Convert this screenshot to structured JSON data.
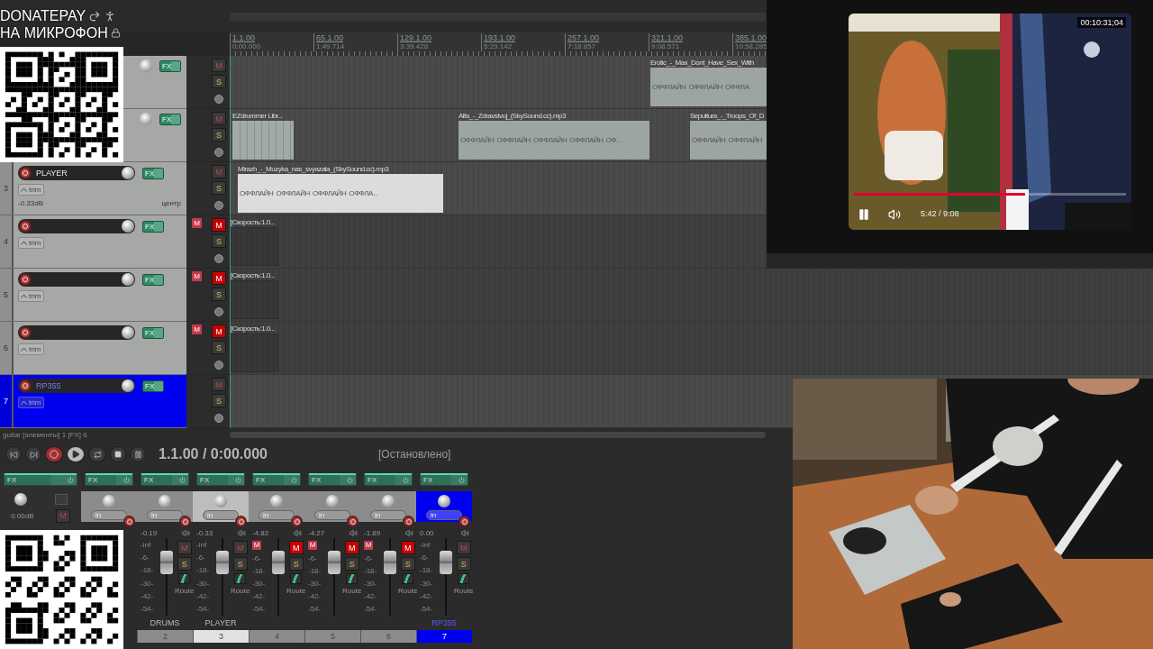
{
  "overlay": {
    "donate_title": "DONATEPAY",
    "donate_subtitle": "НА МИКРОФОН"
  },
  "ruler": [
    {
      "bar": "1.1.00",
      "time": "0:00.000"
    },
    {
      "bar": "65.1.00",
      "time": "1:49.714"
    },
    {
      "bar": "129.1.00",
      "time": "3:39.428"
    },
    {
      "bar": "193.1.00",
      "time": "5:29.142"
    },
    {
      "bar": "257.1.00",
      "time": "7:18.857"
    },
    {
      "bar": "321.1.00",
      "time": "9:08.571"
    },
    {
      "bar": "385.1.00",
      "time": "10:58.285"
    }
  ],
  "tracks": [
    {
      "selected": false,
      "muted": false,
      "fx": "FX",
      "mute": "M",
      "solo": "S",
      "items": [
        {
          "kind": "audio",
          "selected": false,
          "title": "Erotic_-_Max_Dont_Have_Sex_With",
          "offline": [
            "ОФФЛАЙН",
            "ОФФЛАЙН",
            "ОФФЛА"
          ]
        }
      ]
    },
    {
      "selected": false,
      "muted": false,
      "fx": "FX",
      "mute": "M",
      "solo": "S",
      "items": [
        {
          "kind": "midi",
          "selected": false,
          "title": "EZdrummer Libr..."
        },
        {
          "kind": "audio",
          "selected": false,
          "title": "Alfa_-_Zdravstvuj_(SkySound.cc).mp3",
          "offline": [
            "ОФФЛАЙН",
            "ОФФЛАЙН",
            "ОФФЛАЙН",
            "ОФФЛАЙН",
            "ОФ..."
          ]
        },
        {
          "kind": "audio",
          "selected": false,
          "title": "Sepultura_-_Troops_Of_D",
          "offline": [
            "ОФФЛАЙН",
            "ОФФЛАЙН"
          ]
        }
      ]
    },
    {
      "number": "3",
      "name": "PLAYER",
      "selected": false,
      "muted": false,
      "fx": "FX",
      "trim": "trim",
      "volume": "-0.33dB",
      "pan": "центр",
      "mute": "M",
      "solo": "S",
      "items": [
        {
          "kind": "audio",
          "selected": true,
          "title": "Mirazh_-_Muzyka_nas_svyazala_(SkySound.cc).mp3",
          "offline": [
            "ОФФЛАЙН",
            "ОФФЛАЙН",
            "ОФФЛАЙН",
            "ОФФЛА..."
          ]
        }
      ]
    },
    {
      "number": "4",
      "selected": false,
      "muted": true,
      "fx": "FX",
      "trim": "trim",
      "badge": "M",
      "mute": "M",
      "solo": "S",
      "items": [
        {
          "kind": "empty",
          "selected": false,
          "title": "[Скорость:1.0..."
        }
      ]
    },
    {
      "number": "5",
      "selected": false,
      "muted": true,
      "fx": "FX",
      "trim": "trim",
      "badge": "M",
      "mute": "M",
      "solo": "S",
      "items": [
        {
          "kind": "empty",
          "selected": false,
          "title": "[Скорость:1.0..."
        }
      ]
    },
    {
      "number": "6",
      "selected": false,
      "muted": true,
      "fx": "FX",
      "trim": "trim",
      "badge": "M",
      "mute": "M",
      "solo": "S",
      "items": [
        {
          "kind": "empty",
          "selected": false,
          "title": "[Скорость:1.0..."
        }
      ]
    },
    {
      "number": "7",
      "name": "RP355",
      "selected": true,
      "muted": false,
      "fx": "FX",
      "trim": "trim",
      "mute": "M",
      "solo": "S"
    }
  ],
  "status": "guitar [элементы] 1 [FX] 6",
  "transport": {
    "position": "1.1.00 / 0:00.000",
    "state": "[Остановлено]"
  },
  "master": {
    "fx": "FX",
    "volume": "0.00dB",
    "mute": "M"
  },
  "strips": [
    {
      "selected": false,
      "fx": "FX",
      "in": "in"
    },
    {
      "number": "2",
      "name": "DRUMS",
      "selected": false,
      "muted": false,
      "fx": "FX",
      "in": "in",
      "volume": "-0.19",
      "mute": "M",
      "solo": "S",
      "route": "Route",
      "scale": [
        "-inf",
        "-6-",
        "-18-",
        "-30-",
        "-42-",
        "-54-"
      ]
    },
    {
      "number": "3",
      "name": "PLAYER",
      "selected": true,
      "muted": false,
      "fx": "FX",
      "in": "in",
      "volume": "-0.33",
      "mute": "M",
      "solo": "S",
      "route": "Route",
      "scale": [
        "-inf",
        "-6-",
        "-18-",
        "-30-",
        "-42-",
        "-54-"
      ]
    },
    {
      "number": "4",
      "selected": false,
      "muted": true,
      "fx": "FX",
      "in": "in",
      "volume": "-4.82",
      "badge": "M",
      "mute": "M",
      "solo": "S",
      "route": "Route",
      "scale": [
        "-6-",
        "-18-",
        "-30-",
        "-42-",
        "-54-"
      ]
    },
    {
      "number": "5",
      "selected": false,
      "muted": true,
      "fx": "FX",
      "in": "in",
      "volume": "-4.27",
      "badge": "M",
      "mute": "M",
      "solo": "S",
      "route": "Route",
      "scale": [
        "-6-",
        "-18-",
        "-30-",
        "-42-",
        "-54-"
      ]
    },
    {
      "number": "6",
      "selected": false,
      "muted": true,
      "fx": "FX",
      "in": "in",
      "volume": "-1.89",
      "badge": "M",
      "mute": "M",
      "solo": "S",
      "route": "Route",
      "scale": [
        "-6-",
        "-18-",
        "-30-",
        "-42-",
        "-54-"
      ]
    },
    {
      "number": "7",
      "name": "RP355",
      "selected": true,
      "muted": false,
      "fx": "FX",
      "in": "in",
      "volume": "0.00",
      "mute": "M",
      "solo": "S",
      "route": "Route",
      "scale": [
        "-inf",
        "-6-",
        "-18-",
        "-30-",
        "-42-",
        "-54-"
      ]
    }
  ],
  "video": {
    "timecode": "00:10:31;04",
    "time": "5:42 / 9:08",
    "level": 0.63
  }
}
